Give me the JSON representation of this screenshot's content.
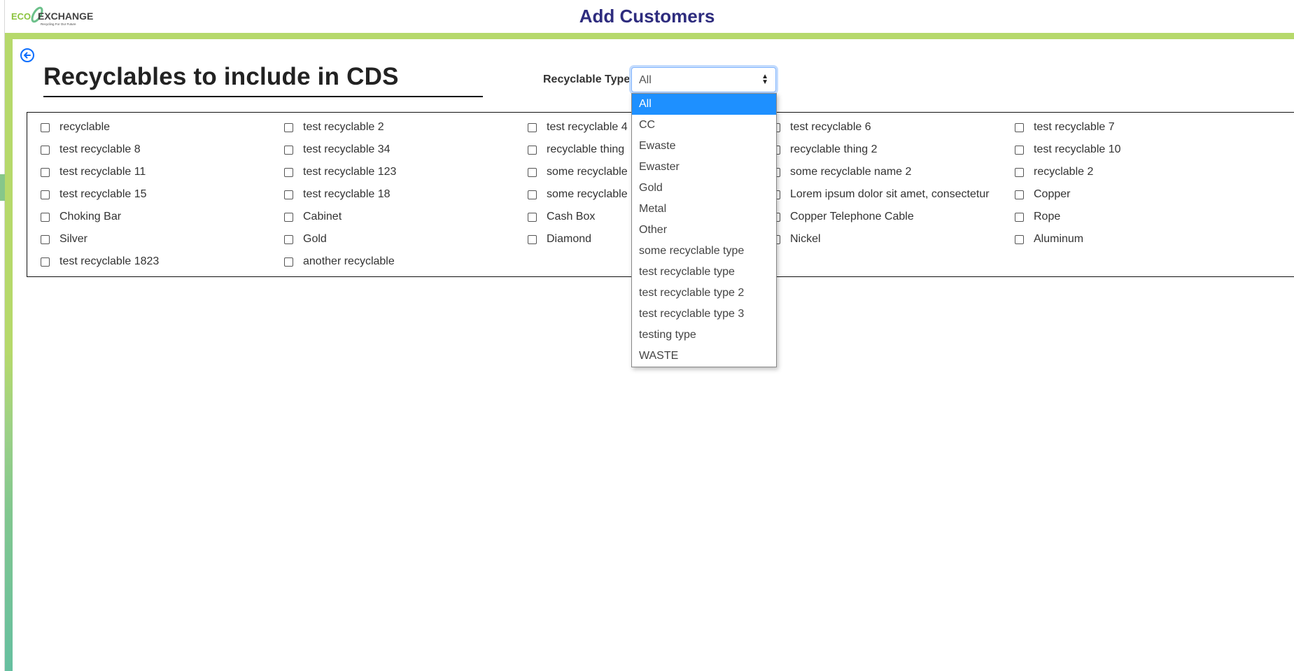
{
  "header": {
    "logo_text": "ECO EXCHANGE",
    "logo_tagline": "Recycling For Our Future",
    "title": "Add Customers"
  },
  "colors": {
    "accent_green": "#b6d96b",
    "title_navy": "#2e2c7e",
    "select_blue": "#1e90ff",
    "back_icon_blue": "#0d6efd"
  },
  "page": {
    "title": "Recyclables to include in CDS",
    "back_icon": "arrow-left-circle-icon"
  },
  "filter": {
    "label": "Recyclable Type:",
    "selected": "All",
    "options": [
      "All",
      "CC",
      "Ewaste",
      "Ewaster",
      "Gold",
      "Metal",
      "Other",
      "some recyclable type",
      "test recyclable type",
      "test recyclable type 2",
      "test recyclable type 3",
      "testing type",
      "WASTE"
    ]
  },
  "recyclables": [
    "recyclable",
    "test recyclable 2",
    "test recyclable 4",
    "test recyclable 6",
    "test recyclable 7",
    "test recyclable 8",
    "test recyclable 34",
    "recyclable thing",
    "recyclable thing 2",
    "test recyclable 10",
    "test recyclable 11",
    "test recyclable 123",
    "some recyclable",
    "some recyclable name 2",
    "recyclable 2",
    "test recyclable 15",
    "test recyclable 18",
    "some recyclable",
    "Lorem ipsum dolor sit amet, consectetur",
    "Copper",
    "Choking Bar",
    "Cabinet",
    "Cash Box",
    "Copper Telephone Cable",
    "Rope",
    "Silver",
    "Gold",
    "Diamond",
    "Nickel",
    "Aluminum",
    "test recyclable 1823",
    "another recyclable"
  ]
}
